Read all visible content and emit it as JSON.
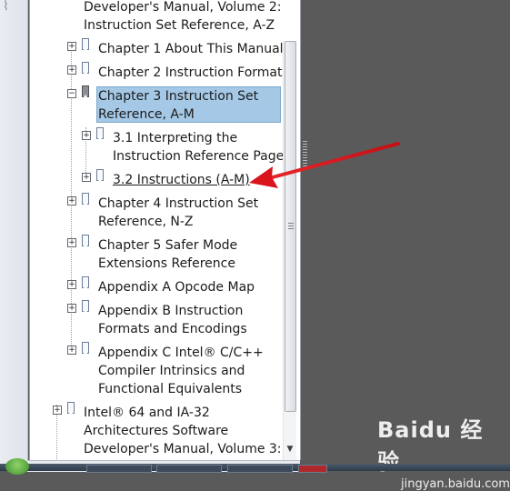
{
  "bookmarks": {
    "partial_top_line1": "Developer's Manual, Volume 2:",
    "partial_top_line2": "Instruction Set Reference, A-Z",
    "ch1": "Chapter 1 About This Manual",
    "ch2": "Chapter 2 Instruction Format",
    "ch3_line1": "Chapter 3 Instruction Set",
    "ch3_line2": "Reference, A-M",
    "s31_line1": "3.1 Interpreting the",
    "s31_line2": "Instruction Reference Pages",
    "s32": "3.2 Instructions (A-M)",
    "ch4_line1": "Chapter 4 Instruction Set",
    "ch4_line2": "Reference, N-Z",
    "ch5_line1": "Chapter 5 Safer Mode",
    "ch5_line2": "Extensions Reference",
    "appA": "Appendix A Opcode Map",
    "appB_line1": "Appendix B Instruction",
    "appB_line2": "Formats and Encodings",
    "appC_line1": "Appendix C Intel® C/C++",
    "appC_line2": "Compiler Intrinsics and",
    "appC_line3": "Functional Equivalents",
    "vol3_line1": "Intel® 64 and IA-32",
    "vol3_line2": "Architectures Software",
    "vol3_line3": "Developer's Manual, Volume 3:"
  },
  "icons": {
    "plus": "⊞",
    "minus": "⊟"
  },
  "watermark": {
    "logo": "Baidu 经验",
    "url": "jingyan.baidu.com"
  },
  "colors": {
    "selection": "#a4c8e6",
    "arrow": "#d9141b",
    "doc_area": "#5a5a5a"
  }
}
